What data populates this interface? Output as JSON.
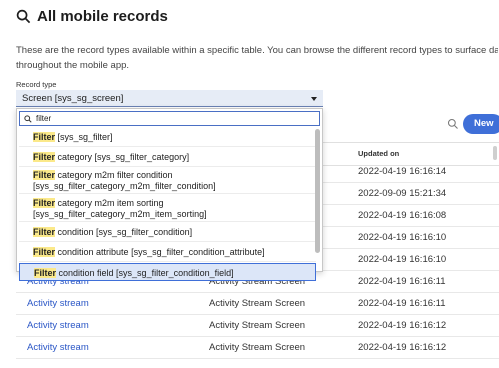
{
  "header": {
    "title": "All mobile records",
    "description_line1": "These are the record types available within a specific table. You can browse the different record types to surface data",
    "description_line2": "throughout the mobile app."
  },
  "record_type": {
    "label": "Record type",
    "selected": "Screen [sys_sg_screen]",
    "search_value": "filter"
  },
  "dropdown": {
    "items": [
      {
        "match": "Filter",
        "rest": " [sys_sg_filter]",
        "rest2": ""
      },
      {
        "match": "Filter",
        "rest": " category [sys_sg_filter_category]",
        "rest2": ""
      },
      {
        "match": "Filter",
        "rest": " category m2m filter condition",
        "rest2": "[sys_sg_filter_category_m2m_filter_condition]"
      },
      {
        "match": "Filter",
        "rest": " category m2m item sorting",
        "rest2": "[sys_sg_filter_category_m2m_item_sorting]"
      },
      {
        "match": "Filter",
        "rest": " condition [sys_sg_filter_condition]",
        "rest2": ""
      },
      {
        "match": "Filter",
        "rest": " condition attribute [sys_sg_filter_condition_attribute]",
        "rest2": ""
      },
      {
        "match": "Filter",
        "rest": " condition field [sys_sg_filter_condition_field]",
        "rest2": ""
      }
    ]
  },
  "table": {
    "new_label": "New",
    "col_updated": "Updated on",
    "rows": [
      {
        "name": "",
        "type": "",
        "updated": "2022-04-19 16:16:14"
      },
      {
        "name": "",
        "type": "",
        "updated": "2022-09-09 15:21:34"
      },
      {
        "name": "",
        "type": "",
        "updated": "2022-04-19 16:16:08"
      },
      {
        "name": "",
        "type": "",
        "updated": "2022-04-19 16:16:10"
      },
      {
        "name": "",
        "type": "",
        "updated": "2022-04-19 16:16:10"
      },
      {
        "name": "Activity stream",
        "type": "Activity Stream Screen",
        "updated": "2022-04-19 16:16:11"
      },
      {
        "name": "Activity stream",
        "type": "Activity Stream Screen",
        "updated": "2022-04-19 16:16:11"
      },
      {
        "name": "Activity stream",
        "type": "Activity Stream Screen",
        "updated": "2022-04-19 16:16:12"
      },
      {
        "name": "Activity stream",
        "type": "Activity Stream Screen",
        "updated": "2022-04-19 16:16:12"
      }
    ]
  },
  "icons": {
    "title": "search-icon",
    "dropdown_search": "search-icon",
    "table_search": "search-icon"
  },
  "colors": {
    "accent": "#3f6fd8",
    "highlight": "#fbe98a",
    "link": "#2a56c6"
  }
}
